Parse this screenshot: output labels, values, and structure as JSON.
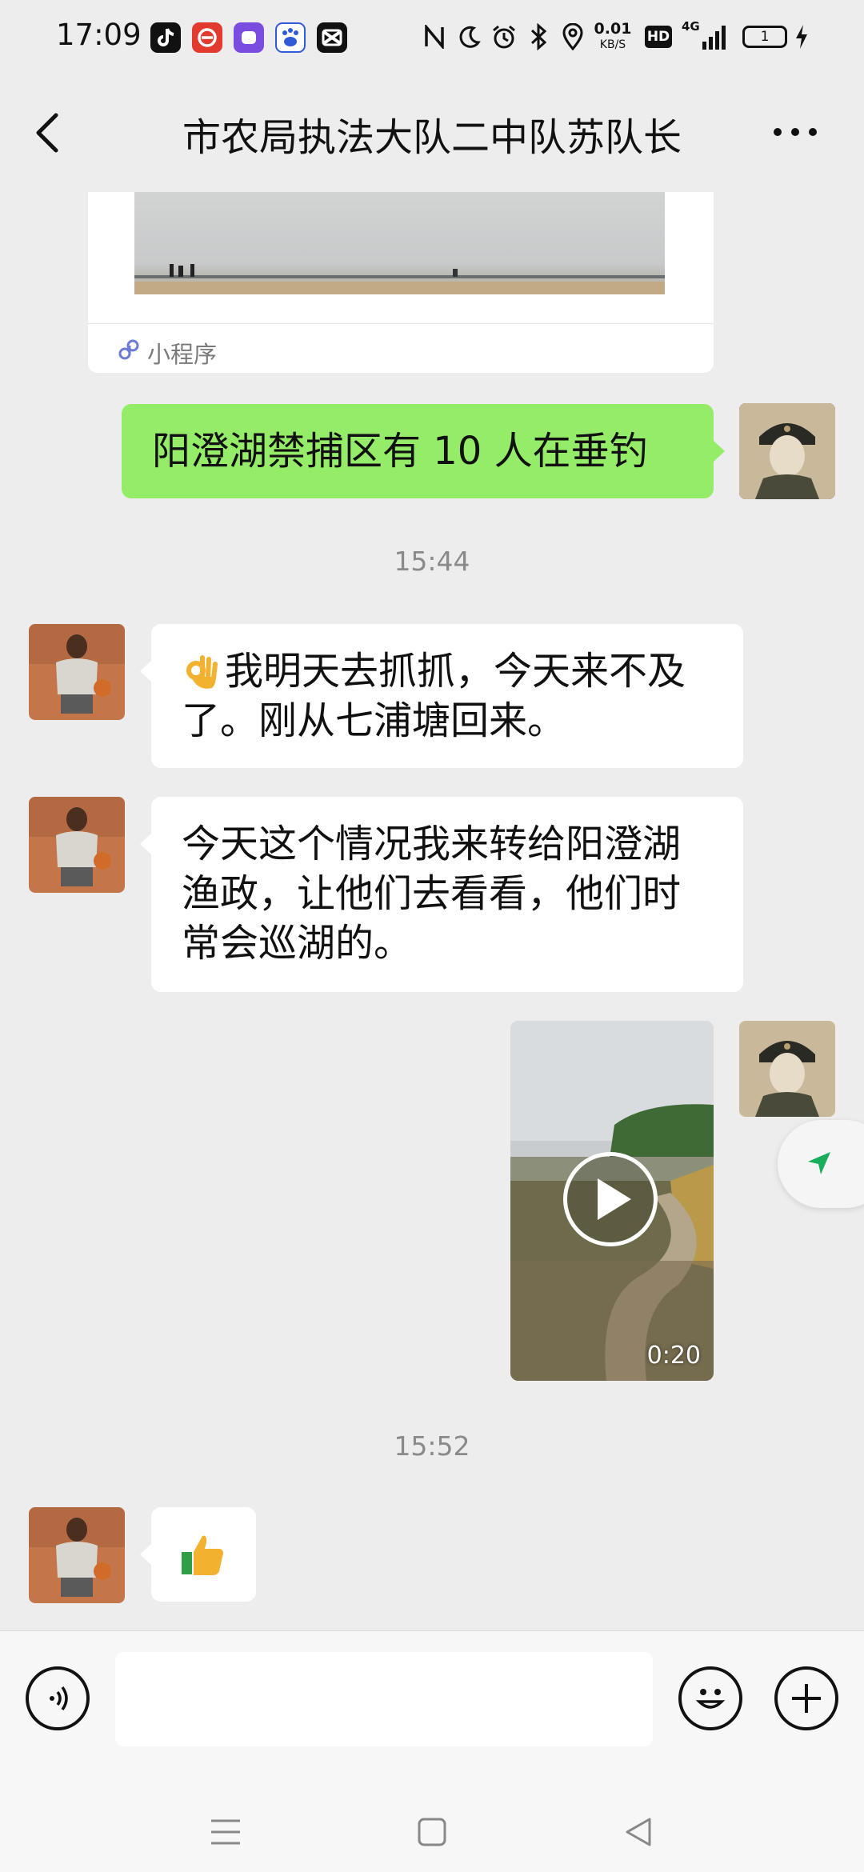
{
  "status_bar": {
    "time": "17:09",
    "network_speed_value": "0.01",
    "network_speed_unit": "KB/S",
    "hd_label": "HD",
    "signal_label": "4G",
    "battery_level": "1",
    "icons": [
      "tiktok-icon",
      "app-red-icon",
      "app-purple-icon",
      "baidu-icon",
      "capcut-icon",
      "nfc-icon",
      "moon-icon",
      "alarm-icon",
      "bluetooth-icon",
      "location-icon",
      "hd-icon",
      "signal-icon",
      "battery-icon",
      "charging-icon"
    ]
  },
  "header": {
    "back_icon": "chevron-left-icon",
    "title": "市农局执法大队二中队苏队长",
    "more_icon": "more-dots-icon"
  },
  "messages": {
    "mini_program": {
      "label": "小程序",
      "icon": "mini-program-icon"
    },
    "out_text": "阳澄湖禁捕区有 10 人在垂钓",
    "time_1": "15:44",
    "in_1": {
      "line1": "我明天去抓抓，今天来不及",
      "line2": "了。刚从七浦塘回来。",
      "emoji": "ok-hand-icon"
    },
    "in_2": {
      "line1": "今天这个情况我来转给阳澄湖",
      "line2": "渔政，让他们去看看，他们时",
      "line3": "常会巡湖的。"
    },
    "video": {
      "duration": "0:20",
      "icon": "play-icon"
    },
    "time_2": "15:52",
    "in_3": {
      "emoji": "thumbs-up-icon"
    }
  },
  "input_bar": {
    "voice_icon": "voice-icon",
    "text_value": "",
    "emoji_icon": "smiley-icon",
    "plus_icon": "plus-icon"
  },
  "colors": {
    "bubble_out": "#95ec69",
    "bubble_in": "#ffffff",
    "background": "#ededed"
  }
}
